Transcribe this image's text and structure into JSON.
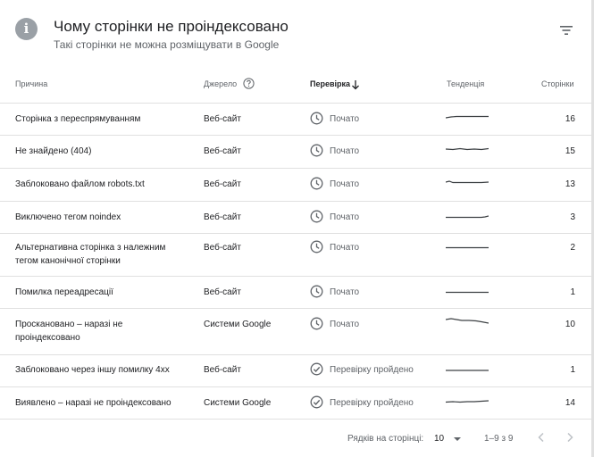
{
  "header": {
    "info_icon_glyph": "i",
    "title": "Чому сторінки не проіндексовано",
    "subtitle": "Такі сторінки не можна розміщувати в Google"
  },
  "columns": {
    "reason": "Причина",
    "source": "Джерело",
    "validation": "Перевірка",
    "trend": "Тенденція",
    "pages": "Сторінки"
  },
  "rows": [
    {
      "reason": "Сторінка з переспрямуванням",
      "source": "Веб-сайт",
      "status": "Почато",
      "status_icon": "clock-icon",
      "pages": "16"
    },
    {
      "reason": "Не знайдено (404)",
      "source": "Веб-сайт",
      "status": "Почато",
      "status_icon": "clock-icon",
      "pages": "15"
    },
    {
      "reason": "Заблоковано файлом robots.txt",
      "source": "Веб-сайт",
      "status": "Почато",
      "status_icon": "clock-icon",
      "pages": "13"
    },
    {
      "reason": "Виключено тегом noindex",
      "source": "Веб-сайт",
      "status": "Почато",
      "status_icon": "clock-icon",
      "pages": "3"
    },
    {
      "reason": "Альтернативна сторінка з належним тегом канонічної сторінки",
      "source": "Веб-сайт",
      "status": "Почато",
      "status_icon": "clock-icon",
      "pages": "2"
    },
    {
      "reason": "Помилка переадресації",
      "source": "Веб-сайт",
      "status": "Почато",
      "status_icon": "clock-icon",
      "pages": "1"
    },
    {
      "reason": "Проскановано – наразі не проіндексовано",
      "source": "Системи Google",
      "status": "Почато",
      "status_icon": "clock-icon",
      "pages": "10"
    },
    {
      "reason": "Заблоковано через іншу помилку 4xx",
      "source": "Веб-сайт",
      "status": "Перевірку пройдено",
      "status_icon": "check-circle-icon",
      "pages": "1"
    },
    {
      "reason": "Виявлено – наразі не проіндексовано",
      "source": "Системи Google",
      "status": "Перевірку пройдено",
      "status_icon": "check-circle-icon",
      "pages": "14"
    }
  ],
  "footer": {
    "rows_per_page_label": "Рядків на сторінці:",
    "rows_per_page_value": "10",
    "range": "1–9 з 9"
  },
  "colors": {
    "text": "#202124",
    "muted": "#5f6368",
    "divider": "#e0e0e0",
    "icon_grey": "#9aa0a6",
    "sparkline": "#3c4043"
  }
}
